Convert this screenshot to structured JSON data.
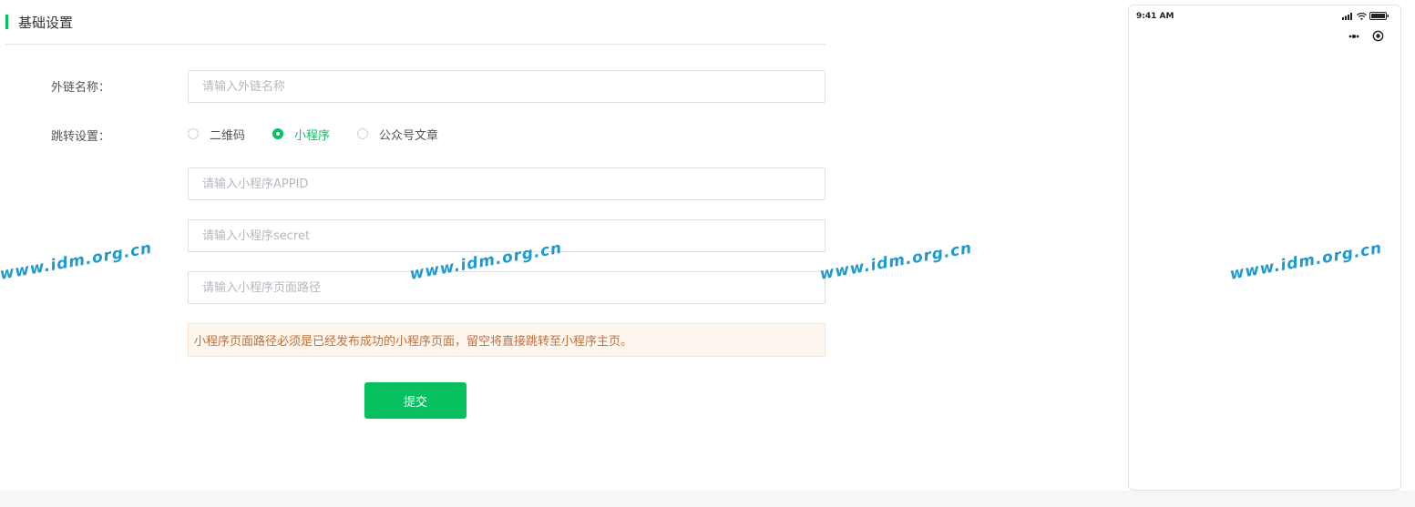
{
  "section": {
    "title": "基础设置"
  },
  "form": {
    "name_label": "外链名称：",
    "name_placeholder": "请输入外链名称",
    "redirect_label": "跳转设置：",
    "redirect_options": [
      {
        "label": "二维码",
        "checked": false
      },
      {
        "label": "小程序",
        "checked": true
      },
      {
        "label": "公众号文章",
        "checked": false
      }
    ],
    "appid_placeholder": "请输入小程序APPID",
    "secret_placeholder": "请输入小程序secret",
    "path_placeholder": "请输入小程序页面路径",
    "notice": "小程序页面路径必须是已经发布成功的小程序页面，留空将直接跳转至小程序主页。",
    "submit_label": "提交"
  },
  "phone": {
    "time": "9:41 AM"
  },
  "watermark": {
    "text": "www.idm.org.cn"
  },
  "colors": {
    "accent": "#07c160",
    "notice_text": "#c0703a",
    "notice_bg": "#fdf6ef",
    "watermark": "#1f9ad0"
  }
}
